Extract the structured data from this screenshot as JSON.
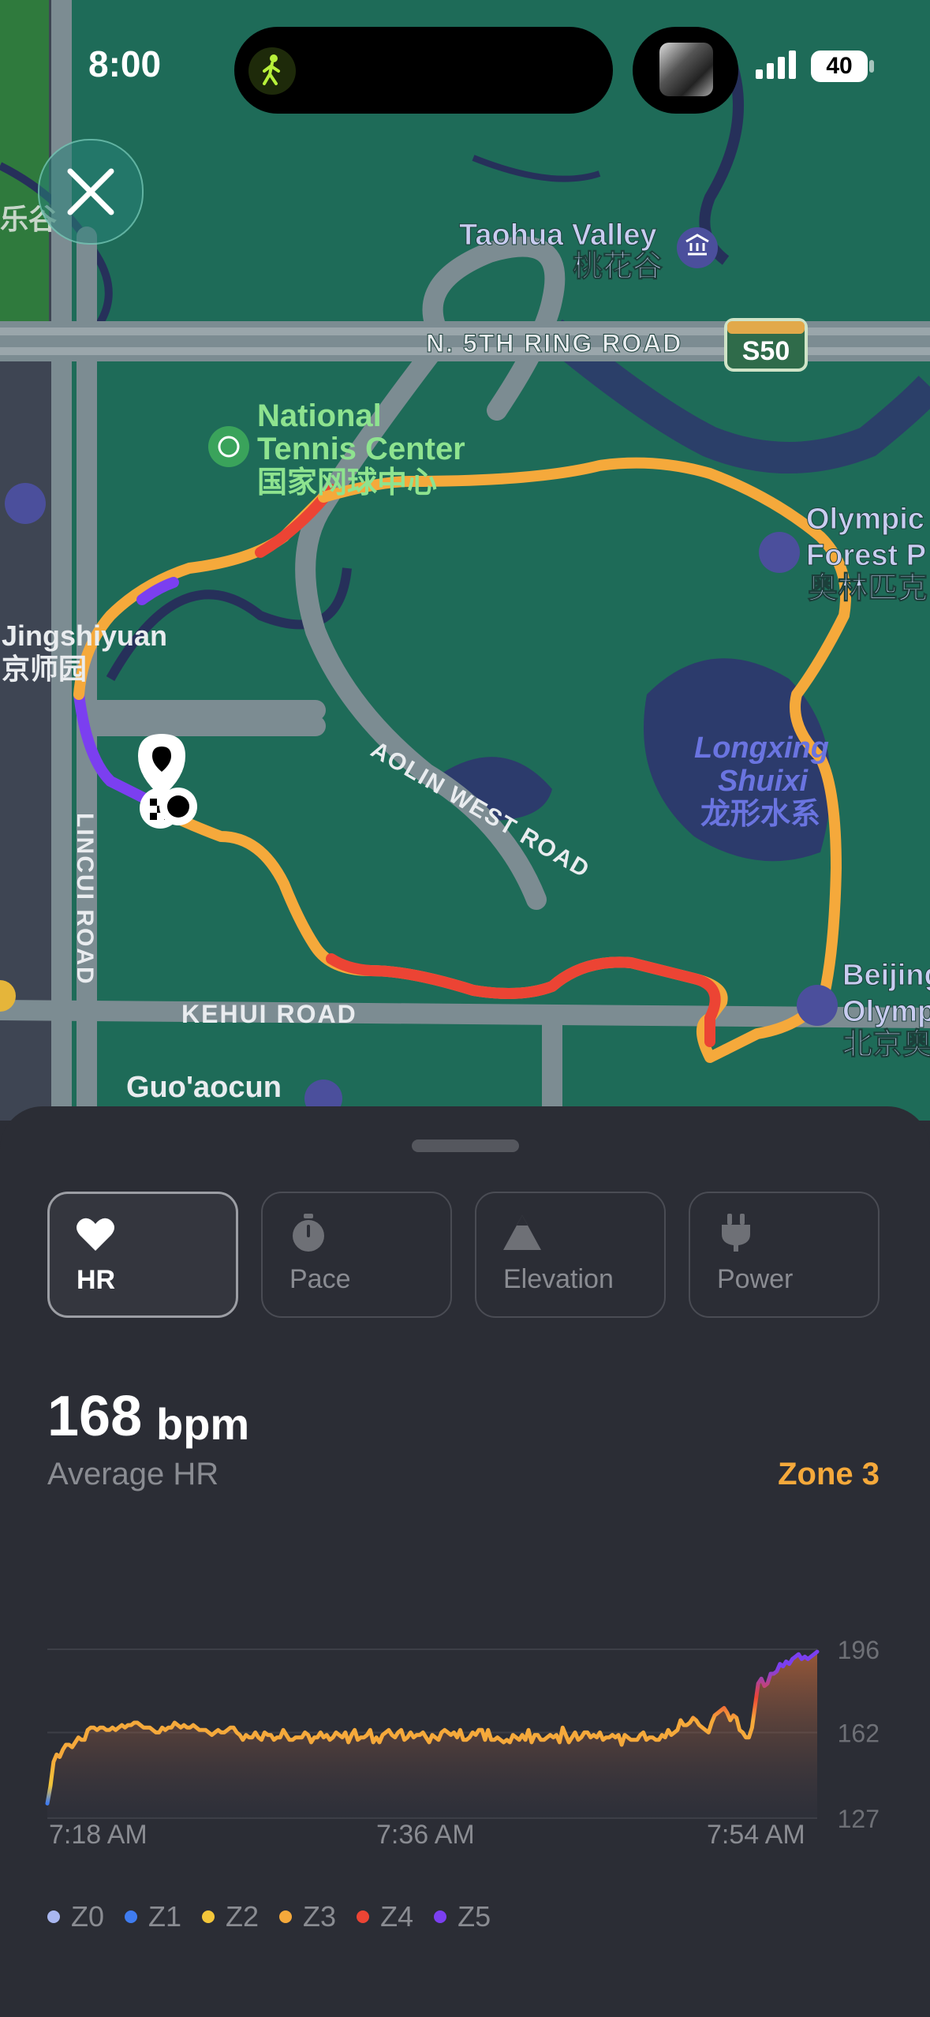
{
  "status_bar": {
    "time": "8:00",
    "battery": "40",
    "activity_icon": "walking-figure-icon"
  },
  "map": {
    "close_icon": "close-icon",
    "labels": {
      "taohua_en": "Taohua Valley",
      "taohua_cn": "桃花谷",
      "ring_road": "N. 5TH RING ROAD",
      "highway_shield": "S50",
      "tennis_en_1": "National",
      "tennis_en_2": "Tennis Center",
      "tennis_cn": "国家网球中心",
      "olympic_forest_1": "Olympic",
      "olympic_forest_2": "Forest P",
      "olympic_forest_cn": "奥林匹克",
      "jingshiyuan_en": "Jingshiyuan",
      "jingshiyuan_cn": "京师园",
      "aolin_road": "AOLIN WEST ROAD",
      "longxing_1": "Longxing",
      "longxing_2": "Shuixi",
      "longxing_cn": "龙形水系",
      "lincui_road": "LINCUI ROAD",
      "kehui_road": "KEHUI ROAD",
      "beijing_1": "Beijing",
      "beijing_2": "Olymp",
      "beijing_cn": "北京奥",
      "guaocun": "Guo'aocun",
      "left_cn": "乐谷"
    }
  },
  "tabs": [
    {
      "label": "HR",
      "icon": "heart-icon",
      "active": true
    },
    {
      "label": "Pace",
      "icon": "stopwatch-icon",
      "active": false
    },
    {
      "label": "Elevation",
      "icon": "mountain-icon",
      "active": false
    },
    {
      "label": "Power",
      "icon": "plug-icon",
      "active": false
    }
  ],
  "summary": {
    "value": "168",
    "unit": "bpm",
    "label": "Average HR",
    "zone": "Zone 3"
  },
  "chart_data": {
    "type": "area",
    "title": "",
    "xlabel": "",
    "ylabel": "",
    "x_ticks": [
      "7:18 AM",
      "7:36 AM",
      "7:54 AM"
    ],
    "y_ticks": [
      196,
      162,
      127
    ],
    "ylim": [
      127,
      196
    ],
    "grid": true,
    "series": [
      {
        "values": [
          133,
          140,
          150,
          153,
          152,
          155,
          157,
          157,
          156,
          158,
          160,
          159,
          159,
          163,
          164,
          164,
          163,
          164,
          164,
          163,
          163,
          164,
          163,
          164,
          165,
          164,
          165,
          165,
          166,
          166,
          165,
          164,
          164,
          164,
          163,
          162,
          162,
          164,
          163,
          164,
          164,
          166,
          165,
          164,
          165,
          164,
          164,
          165,
          164,
          163,
          163,
          163,
          162,
          161,
          162,
          163,
          162,
          162,
          163,
          164,
          164,
          162,
          161,
          159,
          161,
          160,
          160,
          162,
          160,
          159,
          162,
          161,
          161,
          159,
          160,
          160,
          163,
          161,
          159,
          159,
          160,
          160,
          160,
          162,
          161,
          158,
          160,
          160,
          162,
          160,
          161,
          159,
          160,
          162,
          161,
          160,
          162,
          158,
          161,
          163,
          159,
          160,
          160,
          161,
          163,
          158,
          160,
          158,
          161,
          162,
          163,
          161,
          160,
          162,
          163,
          159,
          160,
          162,
          160,
          161,
          161,
          162,
          160,
          158,
          161,
          160,
          159,
          162,
          163,
          162,
          161,
          162,
          160,
          163,
          159,
          159,
          160,
          162,
          161,
          163,
          163,
          159,
          163,
          159,
          159,
          160,
          159,
          158,
          159,
          158,
          161,
          160,
          159,
          161,
          159,
          163,
          158,
          161,
          161,
          159,
          159,
          160,
          161,
          160,
          161,
          158,
          164,
          161,
          158,
          160,
          162,
          159,
          160,
          162,
          162,
          160,
          161,
          160,
          162,
          159,
          160,
          160,
          161,
          160,
          161,
          157,
          161,
          160,
          159,
          159,
          159,
          161,
          162,
          159,
          160,
          160,
          159,
          159,
          161,
          160,
          163,
          161,
          162,
          163,
          167,
          165,
          165,
          166,
          168,
          167,
          165,
          164,
          163,
          162,
          166,
          169,
          170,
          171,
          172,
          170,
          167,
          169,
          168,
          163,
          162,
          160,
          160,
          164,
          173,
          182,
          184,
          181,
          182,
          186,
          186,
          187,
          190,
          189,
          191,
          190,
          192,
          193,
          194,
          192,
          193,
          192,
          193,
          194,
          195
        ]
      }
    ],
    "zones": [
      {
        "label": "Z0",
        "color": "#a9b7f0"
      },
      {
        "label": "Z1",
        "color": "#3f7cf0"
      },
      {
        "label": "Z2",
        "color": "#f3c63a"
      },
      {
        "label": "Z3",
        "color": "#f5a93b"
      },
      {
        "label": "Z4",
        "color": "#ec4434"
      },
      {
        "label": "Z5",
        "color": "#7b3ff0"
      }
    ]
  }
}
